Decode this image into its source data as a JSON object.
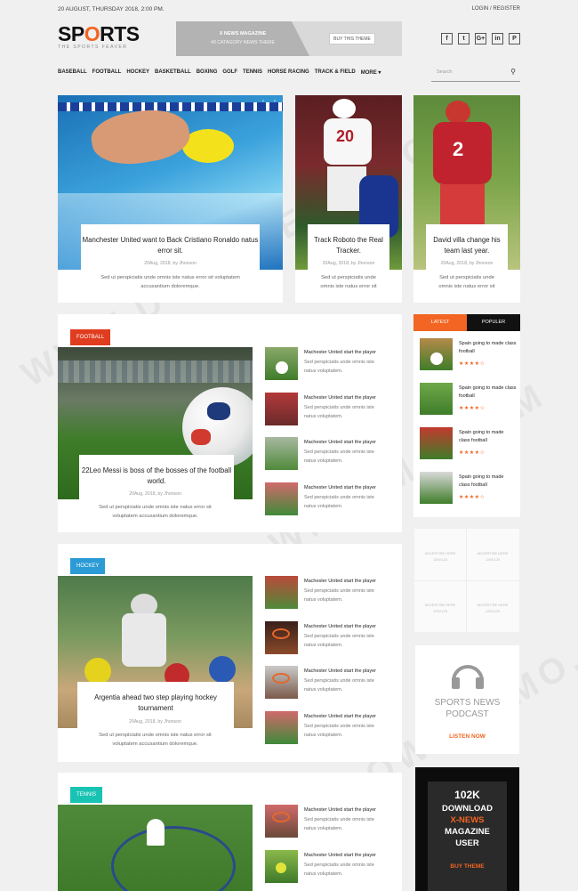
{
  "header": {
    "date": "20 AUGUST, THURSDAY 2018, 2:00 PM.",
    "login": "LOGIN / REGISTER",
    "logo_text": "SPORTS",
    "logo_tag": "THE SPORTS FEAVER"
  },
  "banner": {
    "line1": "X NEWS MAGAZINE",
    "line2": "40 CATAGORY NEWS THEME",
    "button": "BUY THIS THEME"
  },
  "social": [
    "f",
    "t",
    "G+",
    "in",
    "P"
  ],
  "nav": [
    "BASEBALL",
    "FOOTBALL",
    "HOCKEY",
    "BASKETBALL",
    "BOXING",
    "GOLF",
    "TENNIS",
    "HORSE RACING",
    "TRACK & FIELD",
    "MORE ▾"
  ],
  "search": {
    "placeholder": "Search"
  },
  "hero": [
    {
      "title1": "Manchester United want to Back Cristiano Ronaldo natus",
      "title2": "error sit.",
      "meta": "20Aug, 2018, by Jhonson",
      "ex1": "Sed ut perspiciatis unde omnis iste natus error sit voluptatem",
      "ex2": "accusantium doloremque."
    },
    {
      "title1": "Track Roboto the Real",
      "title2": "Tracker.",
      "meta": "20Aug, 2018, by Jhonson",
      "ex1": "Sed ut perspiciatis unde",
      "ex2": "omnis iste natus error sit"
    },
    {
      "title1": "David villa change his",
      "title2": "team last year.",
      "meta": "20Aug, 2018, by Jhonson",
      "ex1": "Sed ut perspiciatis unde",
      "ex2": "omnis iste natus error sit"
    }
  ],
  "sections": [
    {
      "label": "FOOTBALL",
      "title1": "22Leo Messi is boss of the bosses of the football",
      "title2": "world.",
      "meta": "20Aug, 2018, by Jhonson",
      "ex1": "Sed ut perspiciatis unde omnis iste natus error sit",
      "ex2": "voluptatem accusantium doloremque."
    },
    {
      "label": "HOCKEY",
      "title1": "Argentia ahead two step playing hockey",
      "title2": "tournament",
      "meta": "20Aug, 2018, by Jhonson",
      "ex1": "Sed ut perspiciatis unde omnis iste natus error sit",
      "ex2": "voluptatem accusantium doloremque."
    },
    {
      "label": "TENNIS"
    }
  ],
  "list_item": {
    "title": "Machester United start the player",
    "ex1": "Sed perspiciatis unde omnis iste",
    "ex2": "natus voluptatem."
  },
  "tabs": {
    "latest": "LATEST",
    "popular": "POPULER"
  },
  "side_items": [
    {
      "t1": "Spain going to made class",
      "t2": "football"
    },
    {
      "t1": "Spain going to made class",
      "t2": "football"
    },
    {
      "t1": "Spain going to made",
      "t2": "class football"
    },
    {
      "t1": "Spain going to made",
      "t2": "class football"
    }
  ],
  "ads": {
    "l1": "ADVERTISE HERE",
    "l2": "125X125"
  },
  "podcast": {
    "l1": "SPORTS NEWS",
    "l2": "PODCAST",
    "cta": "LISTEN NOW"
  },
  "promo": {
    "num": "102K",
    "l1": "DOWNLOAD",
    "l2": "X-NEWS",
    "l3": "MAGAZINE",
    "l4": "USER",
    "btn": "BUY THEME"
  },
  "colors": {
    "accent": "#f26522",
    "football": "#e03c1f",
    "hockey": "#2b9bd6",
    "tennis": "#19c3b4"
  }
}
